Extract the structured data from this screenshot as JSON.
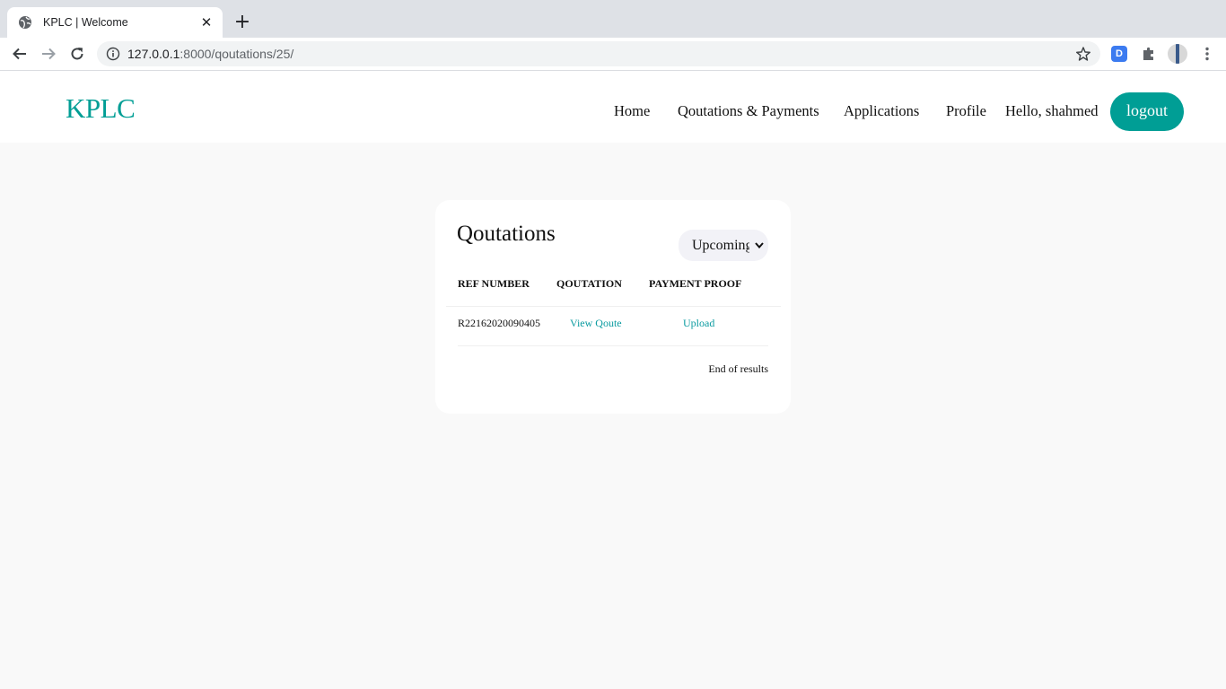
{
  "browser": {
    "tab_title": "KPLC | Welcome",
    "url_host": "127.0.0.1",
    "url_rest": ":8000/qoutations/25/",
    "close_glyph": "✕",
    "newtab_glyph": "+",
    "extension_letter": "D"
  },
  "header": {
    "brand": "KPLC",
    "nav": [
      "Home",
      "Qoutations & Payments",
      "Applications",
      "Profile"
    ],
    "greeting": "Hello, shahmed",
    "logout_label": "logout"
  },
  "card": {
    "title": "Qoutations",
    "filter_value": "Upcoming",
    "columns": [
      "REF NUMBER",
      "QOUTATION",
      "PAYMENT PROOF"
    ],
    "rows": [
      {
        "ref": "R22162020090405",
        "quote_link": "View Qoute",
        "proof_link": "Upload"
      }
    ],
    "end_note": "End of results"
  },
  "colors": {
    "brand": "#009e95",
    "link": "#0a9ba0",
    "page_bg": "#f9f9f9"
  },
  "icons": {
    "tab_favicon": "globe-icon",
    "back": "back-arrow-icon",
    "forward": "forward-arrow-icon",
    "reload": "reload-icon",
    "site_info": "info-icon",
    "bookmark": "star-icon",
    "extensions": "puzzle-icon",
    "menu": "kebab-menu-icon",
    "filter": "chevron-down-icon"
  }
}
